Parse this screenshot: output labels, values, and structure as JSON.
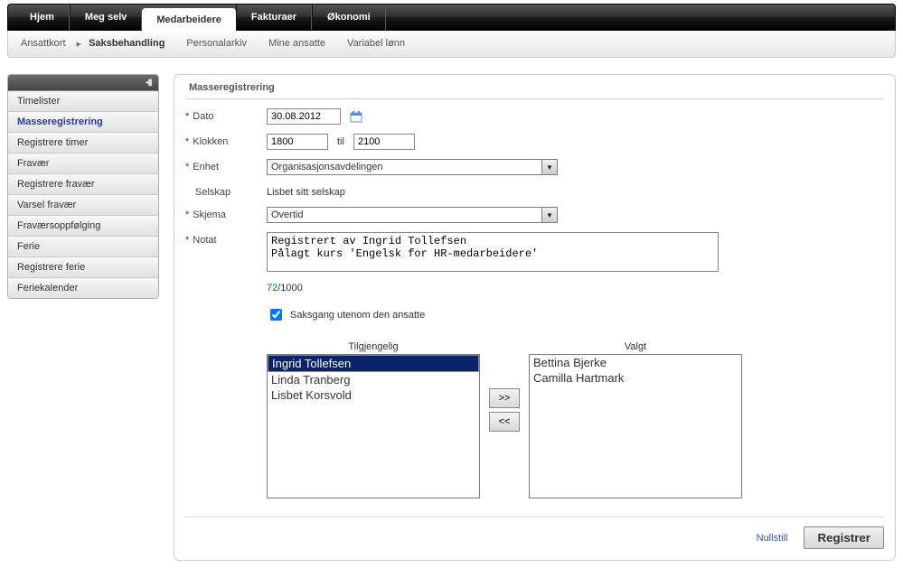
{
  "topnav": {
    "items": [
      "Hjem",
      "Meg selv",
      "Medarbeidere",
      "Fakturaer",
      "Økonomi"
    ],
    "active_index": 2
  },
  "subnav": {
    "items": [
      "Ansattkort",
      "Saksbehandling",
      "Personalarkiv",
      "Mine ansatte",
      "Variabel lønn"
    ],
    "bold_index": 1
  },
  "sidebar": {
    "items": [
      "Timelister",
      "Masseregistrering",
      "Registrere timer",
      "Fravær",
      "Registrere fravær",
      "Varsel fravær",
      "Fraværsoppfølging",
      "Ferie",
      "Registrere ferie",
      "Feriekalender"
    ],
    "selected_index": 1
  },
  "panel": {
    "title": "Masseregistrering",
    "labels": {
      "dato": "Dato",
      "klokken": "Klokken",
      "til": "til",
      "enhet": "Enhet",
      "selskap": "Selskap",
      "skjema": "Skjema",
      "notat": "Notat",
      "saksgang": "Saksgang utenom den ansatte",
      "tilgjengelig": "Tilgjengelig",
      "valgt": "Valgt"
    },
    "values": {
      "dato": "30.08.2012",
      "fra": "1800",
      "til": "2100",
      "enhet": "Organisasjonsavdelingen",
      "selskap": "Lisbet sitt selskap",
      "skjema": "Overtid",
      "notat": "Registrert av Ingrid Tollefsen\nPålagt kurs 'Engelsk for HR-medarbeidere'",
      "counter_used": "72",
      "counter_max": "/1000",
      "saksgang_checked": true
    },
    "available": [
      "Ingrid Tollefsen",
      "Linda Tranberg",
      "Lisbet Korsvold"
    ],
    "available_selected_index": 0,
    "selected": [
      "Bettina Bjerke",
      "Camilla Hartmark"
    ],
    "buttons": {
      "move_right": ">>",
      "move_left": "<<",
      "reset": "Nullstill",
      "submit": "Registrer"
    }
  }
}
